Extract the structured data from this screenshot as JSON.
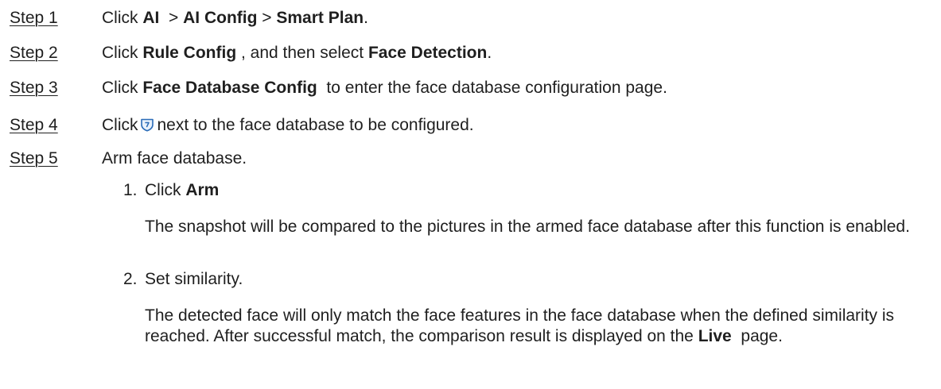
{
  "steps": [
    {
      "label": "Step 1",
      "parts": [
        {
          "t": "Click "
        },
        {
          "t": "AI",
          "b": true
        },
        {
          "t": "  > "
        },
        {
          "t": "AI Config",
          "b": true
        },
        {
          "t": " > "
        },
        {
          "t": "Smart Plan",
          "b": true
        },
        {
          "t": "."
        }
      ]
    },
    {
      "label": "Step 2",
      "parts": [
        {
          "t": "Click "
        },
        {
          "t": "Rule Config",
          "b": true
        },
        {
          "t": " , and then select "
        },
        {
          "t": "Face Detection",
          "b": true
        },
        {
          "t": "."
        }
      ]
    },
    {
      "label": "Step 3",
      "parts": [
        {
          "t": "Click "
        },
        {
          "t": "Face Database Config",
          "b": true
        },
        {
          "t": "  to enter the face database configuration page."
        }
      ]
    },
    {
      "label": "Step 4",
      "before_icon": "Click",
      "icon": "shield-icon",
      "after_icon": "next to the face database to be configured."
    },
    {
      "label": "Step 5",
      "text": "Arm face database."
    }
  ],
  "substeps": [
    {
      "num": "1.",
      "parts": [
        {
          "t": "Click "
        },
        {
          "t": "Arm",
          "b": true
        }
      ],
      "desc": [
        {
          "t": "The snapshot will be compared to the pictures in the armed face database after this function is enabled."
        }
      ]
    },
    {
      "num": "2.",
      "parts": [
        {
          "t": "Set similarity."
        }
      ],
      "desc": [
        {
          "t": "The detected face will only match the face features in the face database when the defined similarity is reached. After successful match, the comparison result is displayed on the "
        },
        {
          "t": "Live",
          "b": true
        },
        {
          "t": "  page."
        }
      ]
    }
  ],
  "colors": {
    "text": "#1f1f1f",
    "icon_stroke": "#2b6cb8",
    "icon_fill": "#e8f1fb"
  }
}
